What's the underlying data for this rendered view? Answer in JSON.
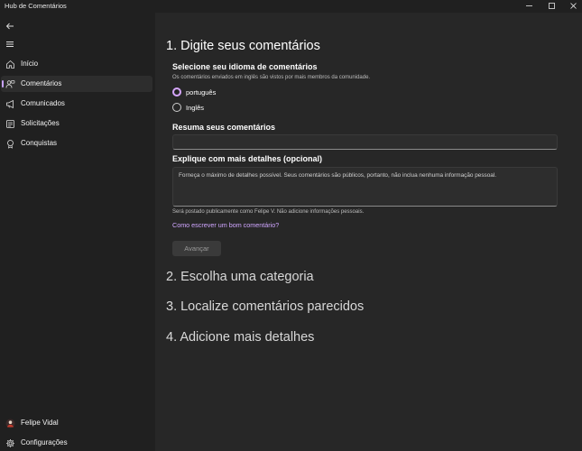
{
  "window": {
    "title": "Hub de Comentários",
    "controls": {
      "minimize": "minimize-icon",
      "maximize": "maximize-icon",
      "close": "close-icon"
    }
  },
  "sidebar": {
    "back_icon": "back-arrow-icon",
    "menu_icon": "hamburger-menu-icon",
    "items": [
      {
        "label": "Início",
        "icon": "home-icon",
        "selected": false
      },
      {
        "label": "Comentários",
        "icon": "people-feedback-icon",
        "selected": true
      },
      {
        "label": "Comunicados",
        "icon": "megaphone-icon",
        "selected": false
      },
      {
        "label": "Solicitações",
        "icon": "list-icon",
        "selected": false
      },
      {
        "label": "Conquistas",
        "icon": "trophy-icon",
        "selected": false
      }
    ],
    "footer": [
      {
        "label": "Felipe Vidal",
        "icon": "avatar"
      },
      {
        "label": "Configurações",
        "icon": "gear-icon"
      }
    ]
  },
  "main": {
    "step1": {
      "title": "1. Digite seus comentários",
      "language_label": "Selecione seu idioma de comentários",
      "language_hint": "Os comentários enviados em inglês são vistos por mais membros da comunidade.",
      "options": [
        {
          "label": "português",
          "checked": true
        },
        {
          "label": "Inglês",
          "checked": false
        }
      ],
      "summary_label": "Resuma seus comentários",
      "summary_value": "",
      "details_label": "Explique com mais detalhes (opcional)",
      "details_placeholder": "Forneça o máximo de detalhes possível. Seus comentários são públicos, portanto, não inclua nenhuma informação pessoal.",
      "public_note": "Será postado publicamente como Felipe V. Não adicione informações pessoais.",
      "help_link": "Como escrever um bom comentário?",
      "advance_button": "Avançar"
    },
    "step2_title": "2. Escolha uma categoria",
    "step3_title": "3. Localize comentários parecidos",
    "step4_title": "4. Adicione mais detalhes"
  },
  "colors": {
    "accent": "#d0a6ff",
    "sidebar_bg": "#202020",
    "content_bg": "#272727"
  }
}
